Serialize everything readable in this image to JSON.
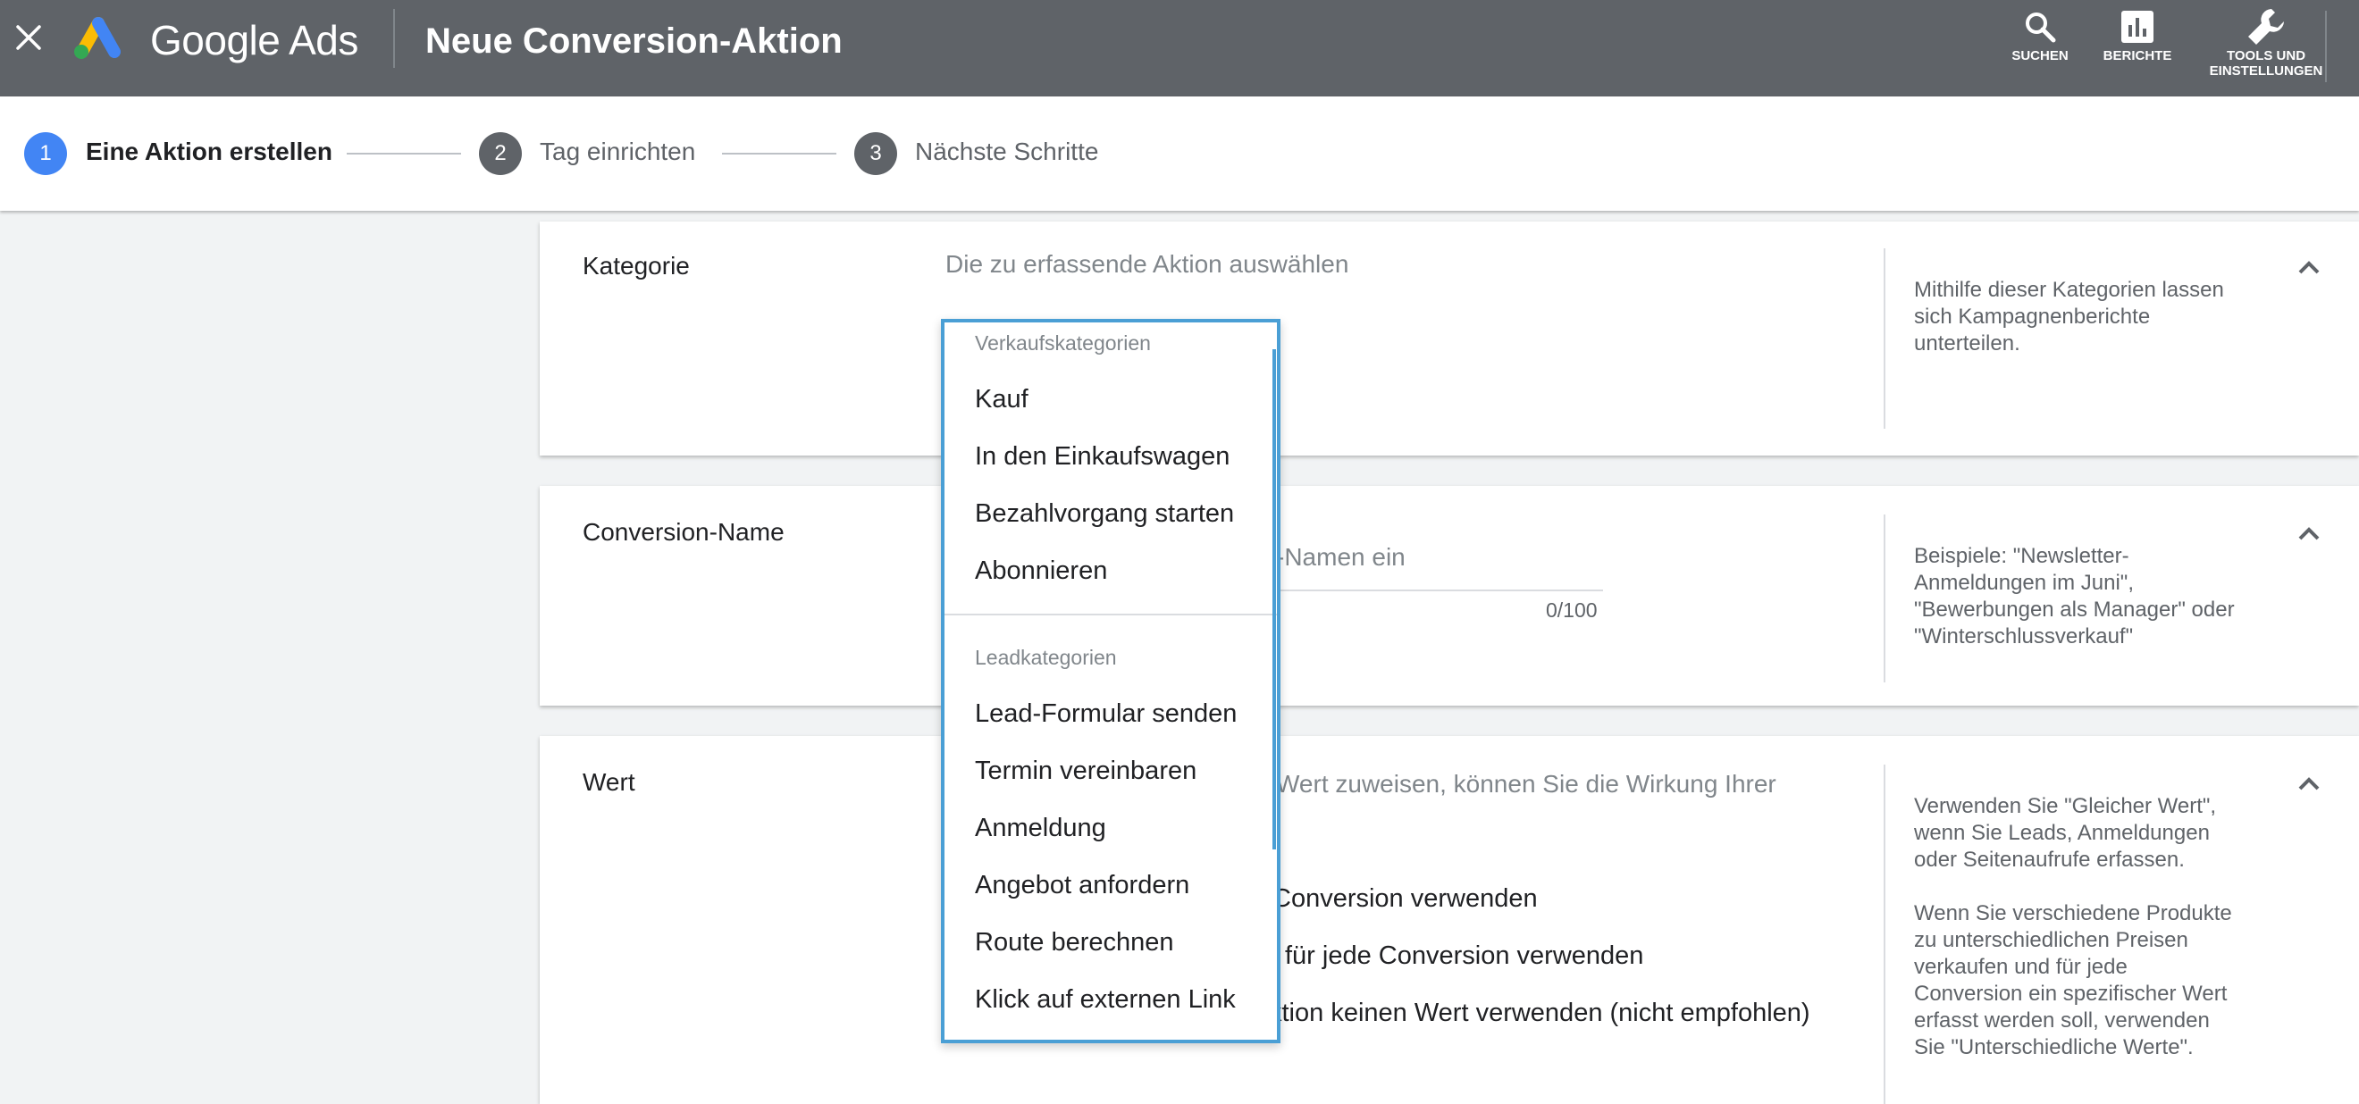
{
  "header": {
    "brand": "Google Ads",
    "page_title": "Neue Conversion-Aktion",
    "tools": {
      "search_label": "SUCHEN",
      "reports_label": "BERICHTE",
      "tools_label_line1": "TOOLS UND",
      "tools_label_line2": "EINSTELLUNGEN"
    },
    "icons": [
      "close-icon",
      "google-ads-logo",
      "search-icon",
      "bar-chart-icon",
      "wrench-icon"
    ]
  },
  "stepper": {
    "steps": [
      {
        "number": "1",
        "label": "Eine Aktion erstellen",
        "state": "active"
      },
      {
        "number": "2",
        "label": "Tag einrichten",
        "state": "inactive"
      },
      {
        "number": "3",
        "label": "Nächste Schritte",
        "state": "inactive"
      }
    ]
  },
  "sections": {
    "kategorie": {
      "title": "Kategorie",
      "placeholder": "Die zu erfassende Aktion auswählen",
      "help": "Mithilfe dieser Kategorien lassen sich Kampagnenberichte unterteilen."
    },
    "conversion_name": {
      "title": "Conversion-Name",
      "input_placeholder_visible": "-Namen ein",
      "counter": "0/100",
      "help": "Beispiele: \"Newsletter-Anmeldungen im Juni\", \"Bewerbungen als Manager\" oder \"Winterschlussverkauf\""
    },
    "wert": {
      "title": "Wert",
      "intro_visible": "Wert zuweisen, können Sie die Wirkung Ihrer",
      "option1_visible": "Conversion verwenden",
      "option2_visible": "für jede Conversion verwenden",
      "option3_visible": "ktion keinen Wert verwenden (nicht empfohlen)",
      "help1": "Verwenden Sie \"Gleicher Wert\", wenn Sie Leads, Anmeldungen oder Seitenaufrufe erfassen.",
      "help2": "Wenn Sie verschiedene Produkte zu unterschiedlichen Preisen verkaufen und für jede Conversion ein spezifischer Wert erfasst werden soll, verwenden Sie \"Unterschiedliche Werte\"."
    }
  },
  "dropdown": {
    "sales_header": "Verkaufskategorien",
    "sales_items": [
      "Kauf",
      "In den Einkaufswagen",
      "Bezahlvorgang starten",
      "Abonnieren"
    ],
    "lead_header": "Leadkategorien",
    "lead_items": [
      "Lead-Formular senden",
      "Termin vereinbaren",
      "Anmeldung",
      "Angebot anfordern",
      "Route berechnen",
      "Klick auf externen Link"
    ]
  },
  "colors": {
    "topbar": "#5f6368",
    "active_step": "#4285f4",
    "inactive_step": "#5f6368",
    "dropdown_border": "#4a9fd5",
    "page_background": "#f1f3f4"
  }
}
